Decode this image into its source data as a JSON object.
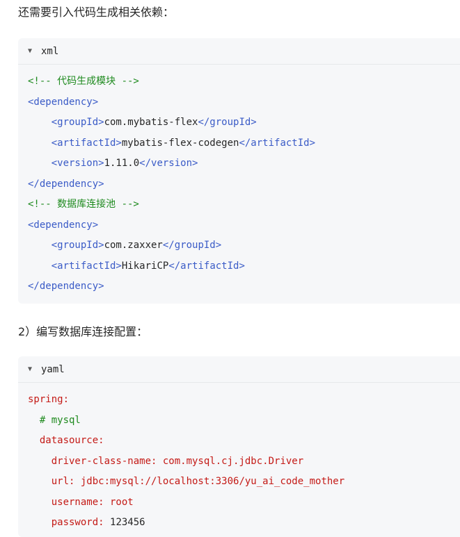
{
  "intro_text": "还需要引入代码生成相关依赖：",
  "step2_text": "2）编写数据库连接配置：",
  "blocks": {
    "xml": {
      "language": "xml",
      "lines": [
        {
          "indent": 0,
          "parts": [
            {
              "t": "<!-- 代码生成模块 -->",
              "c": "comment"
            }
          ]
        },
        {
          "indent": 0,
          "parts": [
            {
              "t": "<dependency>",
              "c": "tag"
            }
          ]
        },
        {
          "indent": 4,
          "parts": [
            {
              "t": "<groupId>",
              "c": "tag"
            },
            {
              "t": "com.mybatis-flex",
              "c": "text"
            },
            {
              "t": "</groupId>",
              "c": "tag"
            }
          ]
        },
        {
          "indent": 4,
          "parts": [
            {
              "t": "<artifactId>",
              "c": "tag"
            },
            {
              "t": "mybatis-flex-codegen",
              "c": "text"
            },
            {
              "t": "</artifactId>",
              "c": "tag"
            }
          ]
        },
        {
          "indent": 4,
          "parts": [
            {
              "t": "<version>",
              "c": "tag"
            },
            {
              "t": "1.11.0",
              "c": "text"
            },
            {
              "t": "</version>",
              "c": "tag"
            }
          ]
        },
        {
          "indent": 0,
          "parts": [
            {
              "t": "</dependency>",
              "c": "tag"
            }
          ]
        },
        {
          "indent": 0,
          "parts": [
            {
              "t": "<!-- 数据库连接池 -->",
              "c": "comment"
            }
          ]
        },
        {
          "indent": 0,
          "parts": [
            {
              "t": "<dependency>",
              "c": "tag"
            }
          ]
        },
        {
          "indent": 4,
          "parts": [
            {
              "t": "<groupId>",
              "c": "tag"
            },
            {
              "t": "com.zaxxer",
              "c": "text"
            },
            {
              "t": "</groupId>",
              "c": "tag"
            }
          ]
        },
        {
          "indent": 4,
          "parts": [
            {
              "t": "<artifactId>",
              "c": "tag"
            },
            {
              "t": "HikariCP",
              "c": "text"
            },
            {
              "t": "</artifactId>",
              "c": "tag"
            }
          ]
        },
        {
          "indent": 0,
          "parts": [
            {
              "t": "</dependency>",
              "c": "tag"
            }
          ]
        }
      ]
    },
    "yaml": {
      "language": "yaml",
      "lines": [
        {
          "indent": 0,
          "parts": [
            {
              "t": "spring:",
              "c": "key"
            }
          ]
        },
        {
          "indent": 2,
          "parts": [
            {
              "t": "# mysql",
              "c": "yamlc"
            }
          ]
        },
        {
          "indent": 2,
          "parts": [
            {
              "t": "datasource:",
              "c": "key"
            }
          ]
        },
        {
          "indent": 4,
          "parts": [
            {
              "t": "driver-class-name: com.mysql.cj.jdbc.Driver",
              "c": "key"
            }
          ]
        },
        {
          "indent": 4,
          "parts": [
            {
              "t": "url: jdbc:mysql://localhost:3306/yu_ai_code_mother",
              "c": "key"
            }
          ]
        },
        {
          "indent": 4,
          "parts": [
            {
              "t": "username: root",
              "c": "key"
            }
          ]
        },
        {
          "indent": 4,
          "parts": [
            {
              "t": "password: ",
              "c": "key"
            },
            {
              "t": "123456",
              "c": "val"
            }
          ]
        }
      ]
    }
  }
}
